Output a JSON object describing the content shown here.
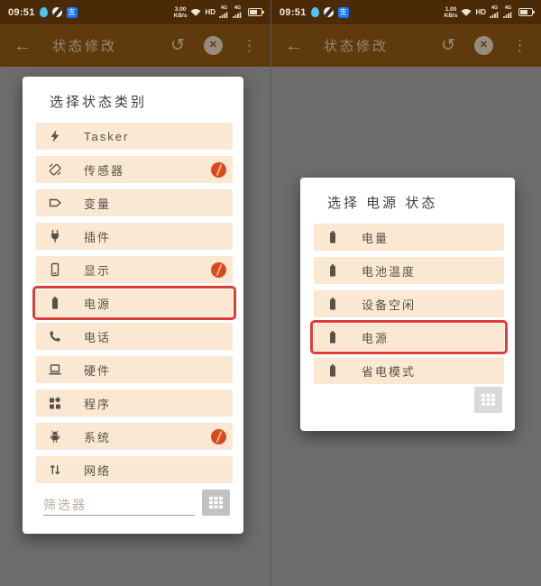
{
  "colors": {
    "statusbar_bg": "#4b2b07",
    "toolbar_bg": "#5f3a0d",
    "scrim_bg": "#6d6d6d",
    "dialog_bg": "#ffffff",
    "row_bg": "#fae8d2",
    "highlight_red": "#e23c36",
    "badge_orange": "#d8491d",
    "alipay_blue": "#1677ff",
    "notification_blue": "#4fc3f7"
  },
  "panels": [
    {
      "status": {
        "time": "09:51",
        "speed_value": "3.00",
        "speed_unit": "KB/s",
        "hd_label": "HD",
        "sim1_label": "4G",
        "sim2_label": "4G",
        "alipay_glyph": "支"
      },
      "toolbar": {
        "title": "状态修改",
        "back_icon": "back-arrow-icon",
        "undo_icon": "undo-icon",
        "close_icon": "close-circle-icon",
        "menu_icon": "overflow-menu-icon"
      },
      "dialog": {
        "title": "选择状态类别",
        "items": [
          {
            "label": "Tasker",
            "icon": "lightning-icon",
            "badge": false,
            "highlight": false
          },
          {
            "label": "传感器",
            "icon": "sensor-icon",
            "badge": true,
            "highlight": false
          },
          {
            "label": "变量",
            "icon": "variable-tag-icon",
            "badge": false,
            "highlight": false
          },
          {
            "label": "插件",
            "icon": "plug-icon",
            "badge": false,
            "highlight": false
          },
          {
            "label": "显示",
            "icon": "display-phone-icon",
            "badge": true,
            "highlight": false
          },
          {
            "label": "电源",
            "icon": "battery-icon",
            "badge": false,
            "highlight": true
          },
          {
            "label": "电话",
            "icon": "phone-handset-icon",
            "badge": false,
            "highlight": false
          },
          {
            "label": "硬件",
            "icon": "laptop-icon",
            "badge": false,
            "highlight": false
          },
          {
            "label": "程序",
            "icon": "apps-grid-icon",
            "badge": false,
            "highlight": false
          },
          {
            "label": "系统",
            "icon": "android-icon",
            "badge": true,
            "highlight": false
          },
          {
            "label": "网络",
            "icon": "network-arrows-icon",
            "badge": false,
            "highlight": false
          }
        ],
        "filter_placeholder": "筛选器",
        "keyboard_icon": "dialpad-icon"
      }
    },
    {
      "status": {
        "time": "09:51",
        "speed_value": "1.00",
        "speed_unit": "KB/s",
        "hd_label": "HD",
        "sim1_label": "4G",
        "sim2_label": "4G",
        "alipay_glyph": "支"
      },
      "toolbar": {
        "title": "状态修改",
        "back_icon": "back-arrow-icon",
        "undo_icon": "undo-icon",
        "close_icon": "close-circle-icon",
        "menu_icon": "overflow-menu-icon"
      },
      "dialog": {
        "title": "选择 电源 状态",
        "items": [
          {
            "label": "电量",
            "icon": "battery-icon",
            "badge": false,
            "highlight": false
          },
          {
            "label": "电池温度",
            "icon": "battery-icon",
            "badge": false,
            "highlight": false
          },
          {
            "label": "设备空闲",
            "icon": "battery-icon",
            "badge": false,
            "highlight": false
          },
          {
            "label": "电源",
            "icon": "battery-icon",
            "badge": false,
            "highlight": true
          },
          {
            "label": "省电模式",
            "icon": "battery-icon",
            "badge": false,
            "highlight": false
          }
        ],
        "keyboard_icon": "dialpad-icon"
      }
    }
  ],
  "glyphs": {
    "back": "←",
    "undo": "↺",
    "close": "✕",
    "menu": "⋮"
  }
}
